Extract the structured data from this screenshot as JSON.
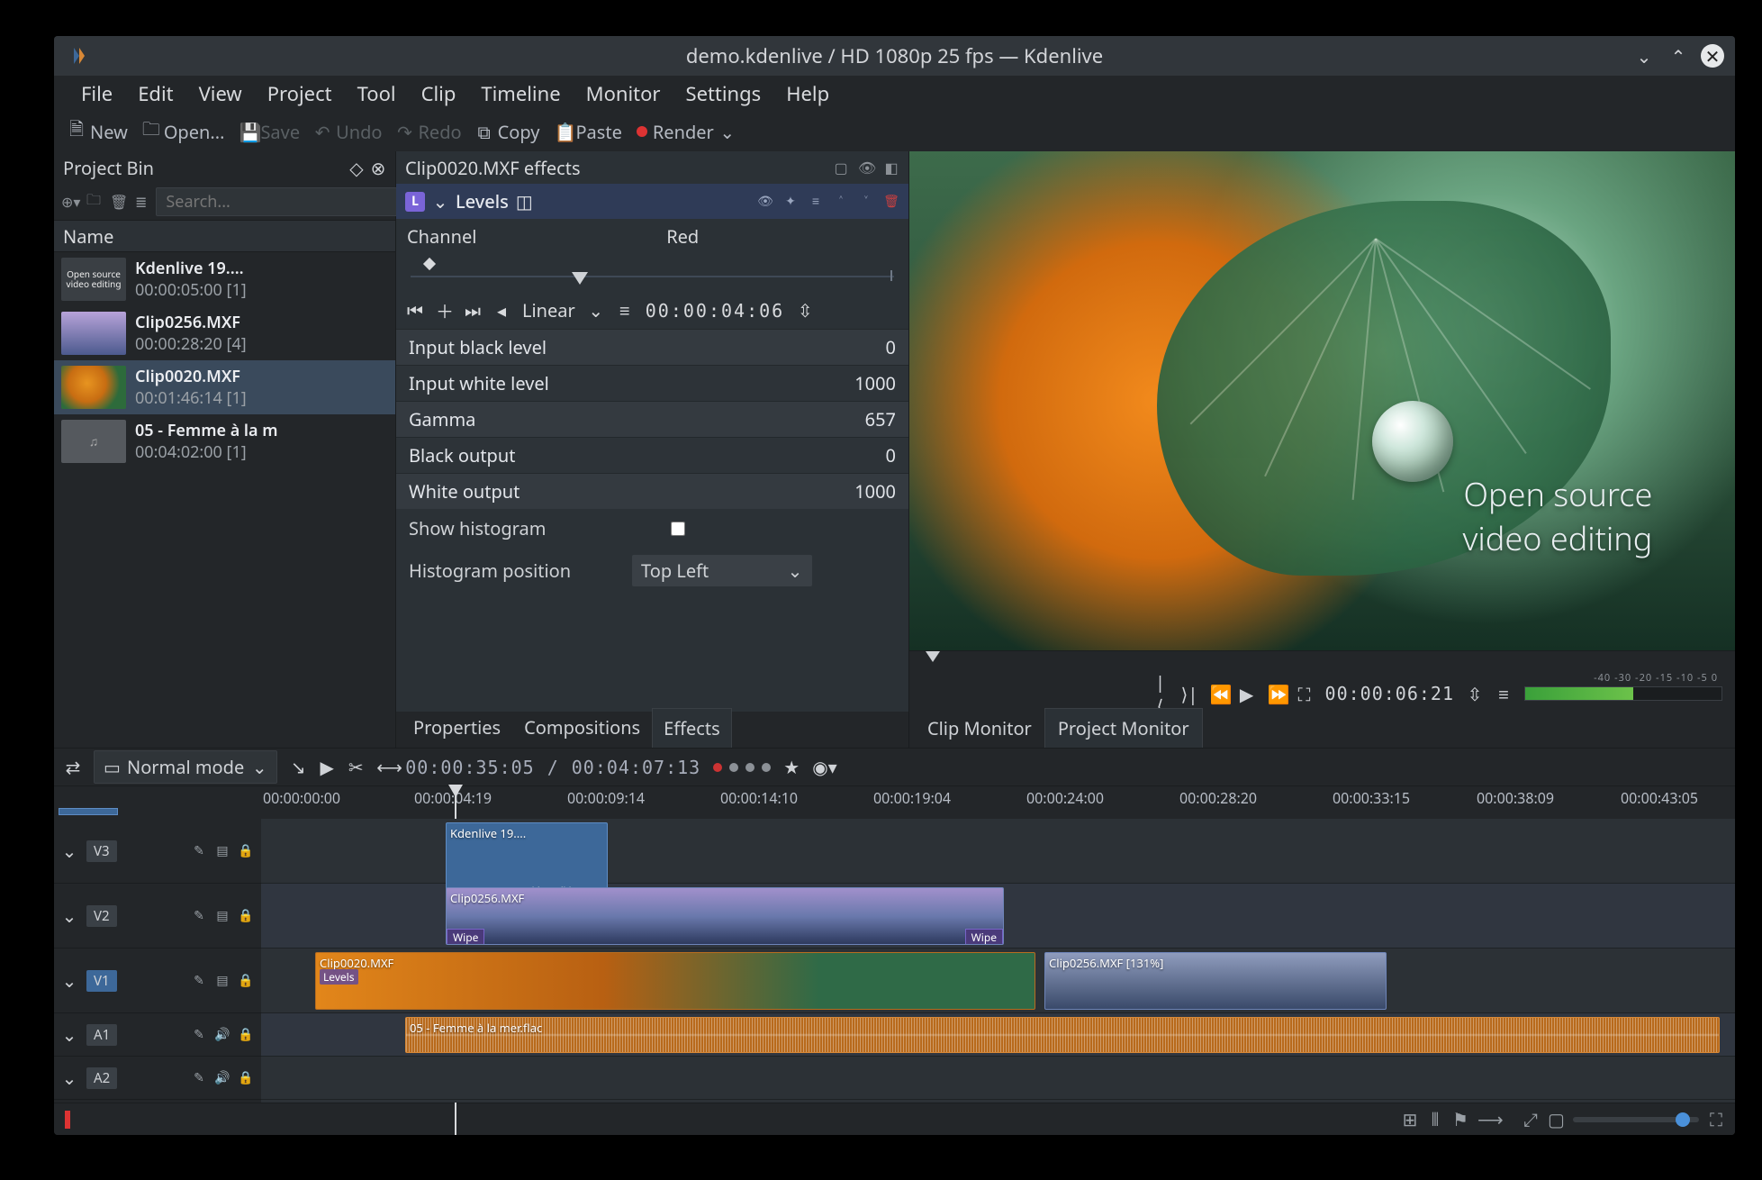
{
  "window": {
    "title": "demo.kdenlive / HD 1080p 25 fps — Kdenlive"
  },
  "menubar": [
    "File",
    "Edit",
    "View",
    "Project",
    "Tool",
    "Clip",
    "Timeline",
    "Monitor",
    "Settings",
    "Help"
  ],
  "toolbar": {
    "new": "New",
    "open": "Open...",
    "save": "Save",
    "undo": "Undo",
    "redo": "Redo",
    "copy": "Copy",
    "paste": "Paste",
    "render": "Render"
  },
  "bin": {
    "title": "Project Bin",
    "search_placeholder": "Search...",
    "column": "Name",
    "items": [
      {
        "name": "Kdenlive 19....",
        "sub": "00:00:05:00 [1]",
        "kind": "title"
      },
      {
        "name": "Clip0256.MXF",
        "sub": "00:00:28:20 [4]",
        "kind": "video1"
      },
      {
        "name": "Clip0020.MXF",
        "sub": "00:01:46:14 [1]",
        "kind": "video2",
        "selected": true
      },
      {
        "name": "05 - Femme à la m",
        "sub": "00:04:02:00 [1]",
        "kind": "audio"
      }
    ]
  },
  "effects": {
    "header": "Clip0020.MXF effects",
    "effect_name": "Levels",
    "channel_label": "Channel",
    "channel_value": "Red",
    "interp": "Linear",
    "keyframe_time": "00:00:04:06",
    "params": [
      {
        "k": "Input black level",
        "v": "0"
      },
      {
        "k": "Input white level",
        "v": "1000"
      },
      {
        "k": "Gamma",
        "v": "657"
      },
      {
        "k": "Black output",
        "v": "0"
      },
      {
        "k": "White output",
        "v": "1000"
      }
    ],
    "show_histogram_label": "Show histogram",
    "hist_pos_label": "Histogram position",
    "hist_pos_value": "Top Left",
    "tabs": {
      "properties": "Properties",
      "compositions": "Compositions",
      "effects": "Effects"
    }
  },
  "monitor": {
    "overlay_line1": "Open source",
    "overlay_line2": "video editing",
    "timecode": "00:00:06:21",
    "vu_marks": "-40  -30  -20  -15  -10   -5    0",
    "tabs": {
      "clip": "Clip Monitor",
      "project": "Project Monitor"
    }
  },
  "timeline": {
    "mode_label": "Normal mode",
    "tc_current": "00:00:35:05",
    "tc_sep": " / ",
    "tc_total": "00:04:07:13",
    "ruler": [
      "00:00:00:00",
      "00:00:04:19",
      "00:00:09:14",
      "00:00:14:10",
      "00:00:19:04",
      "00:00:24:00",
      "00:00:28:20",
      "00:00:33:15",
      "00:00:38:09",
      "00:00:43:05"
    ],
    "tracks": {
      "v3": "V3",
      "v2": "V2",
      "v1": "V1",
      "a1": "A1",
      "a2": "A2"
    },
    "clips": {
      "title_label": "Kdenlive 19....",
      "title_sub": "Open source\nvideo editing",
      "v256_label": "Clip0256.MXF",
      "v20_label": "Clip0020.MXF",
      "v20_fx": "Levels",
      "v256b_label": "Clip0256.MXF [131%]",
      "wipe": "Wipe",
      "audio_label": "05 - Femme à la mer.flac"
    }
  }
}
